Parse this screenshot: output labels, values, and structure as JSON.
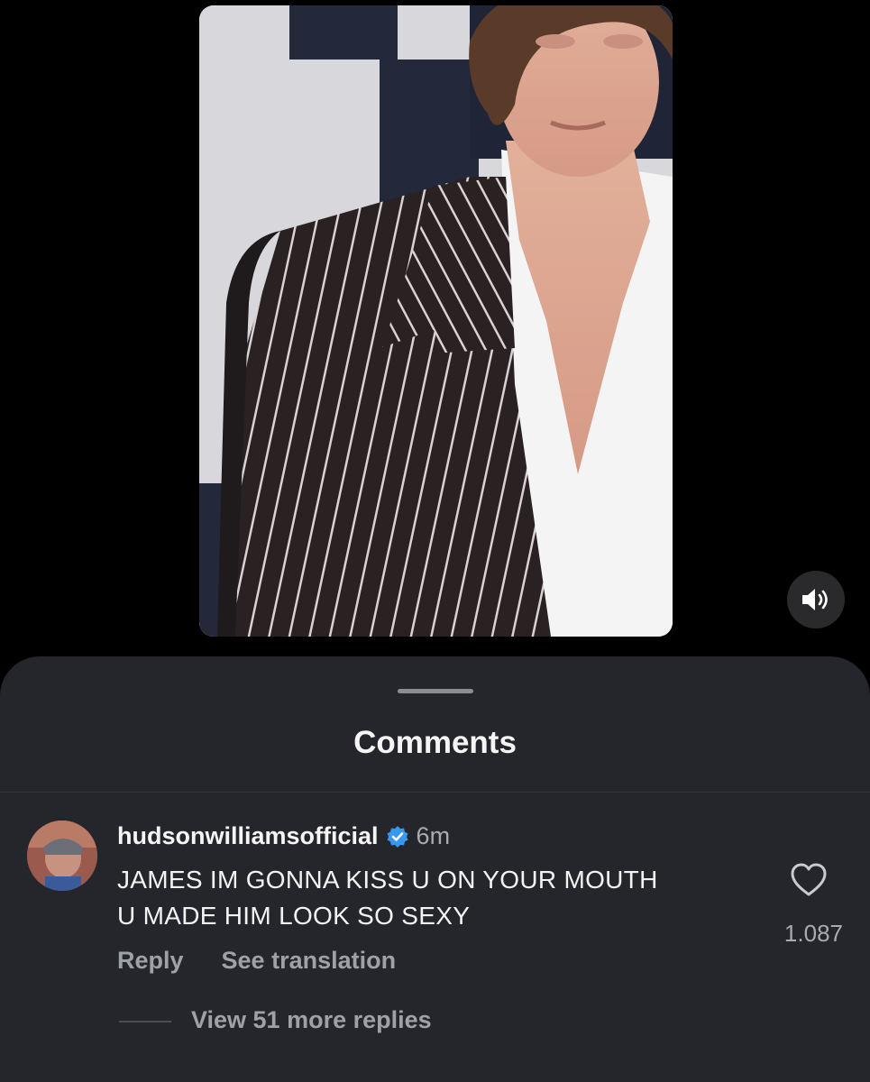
{
  "video": {
    "mute_icon": "speaker-icon"
  },
  "sheet": {
    "title": "Comments"
  },
  "comment": {
    "username": "hudsonwilliamsofficial",
    "verified_icon": "verified-badge-icon",
    "time": "6m",
    "text_line1": "JAMES IM GONNA KISS U ON YOUR MOUTH",
    "text_line2": "U MADE HIM LOOK SO SEXY",
    "reply_label": "Reply",
    "translate_label": "See translation",
    "likes": "1.087",
    "like_icon": "heart-outline-icon",
    "view_replies_label": "View 51 more replies"
  },
  "colors": {
    "background": "#000000",
    "sheet": "#25262b",
    "verified": "#3897f0",
    "muted_text": "#9ea1a8"
  }
}
